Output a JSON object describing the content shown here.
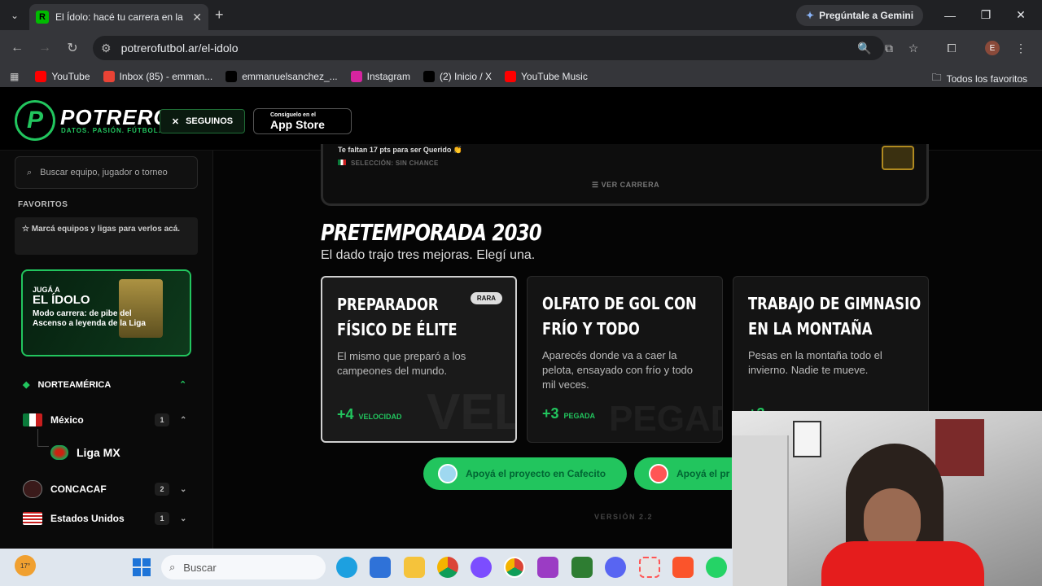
{
  "browser": {
    "tab_title": "El Ídolo: hacé tu carrera en la Li",
    "gemini_label": "Pregúntale a Gemini",
    "url": "potrerofutbol.ar/el-idolo",
    "bookmarks": [
      {
        "label": "YouTube",
        "color": "#ff0000"
      },
      {
        "label": "Inbox (85) - emman...",
        "color": "#ea4335"
      },
      {
        "label": "emmanuelsanchez_...",
        "color": "#000000"
      },
      {
        "label": "Instagram",
        "color": "#d6249f"
      },
      {
        "label": "(2) Inicio / X",
        "color": "#000000"
      },
      {
        "label": "YouTube Music",
        "color": "#ff0000"
      }
    ],
    "all_bookmarks": "Todos los favoritos",
    "avatar_letter": "E"
  },
  "header": {
    "logo_letter": "P",
    "logo": "POTRERO",
    "tagline": "DATOS. PASIÓN. FÚTBOL.",
    "follow_label": "SEGUINOS",
    "appstore_small": "Consíguelo en el",
    "appstore_big": "App Store"
  },
  "sidebar": {
    "search_placeholder": "Buscar equipo, jugador o torneo",
    "favorites_title": "FAVORITOS",
    "favorites_hint": "Marcá equipos y ligas para verlos acá.",
    "promo": {
      "line1": "JUGÁ A",
      "line2": "EL ÍDOLO",
      "line3": "Modo carrera: de pibe del Ascenso a leyenda de la Liga"
    },
    "region": "NORTEAMÉRICA",
    "items": [
      {
        "label": "México",
        "count": "1"
      },
      {
        "label": "Liga MX"
      },
      {
        "label": "CONCACAF",
        "count": "2"
      },
      {
        "label": "Estados Unidos",
        "count": "1"
      }
    ]
  },
  "career": {
    "points_text": "Te faltan 17 pts para ser Querido 👏",
    "selection_text": "SELECCIÓN: SIN CHANCE",
    "view_career": "VER CARRERA"
  },
  "main": {
    "title": "PRETEMPORADA 2030",
    "subtitle": "El dado trajo tres mejoras. Elegí una.",
    "options": [
      {
        "name": "PREPARADOR FÍSICO DE ÉLITE",
        "rarity": "RARA",
        "desc": "El mismo que preparó a los campeones del mundo.",
        "value": "+4",
        "stat": "VELOCIDAD",
        "ghost": "VEL"
      },
      {
        "name": "OLFATO DE GOL CON FRÍO Y TODO",
        "desc": "Aparecés donde va a caer la pelota, ensayado con frío y todo mil veces.",
        "value": "+3",
        "stat": "PEGADA",
        "ghost": "PEGADA"
      },
      {
        "name": "TRABAJO DE GIMNASIO EN LA MONTAÑA",
        "desc": "Pesas en la montaña todo el invierno. Nadie te mueve.",
        "value": "+3"
      }
    ],
    "support_1": "Apoyá el proyecto en Cafecito",
    "support_2": "Apoyá el pr",
    "version": "VERSIÓN 2.2"
  },
  "taskbar": {
    "weather": "17°",
    "search_placeholder": "Buscar"
  }
}
